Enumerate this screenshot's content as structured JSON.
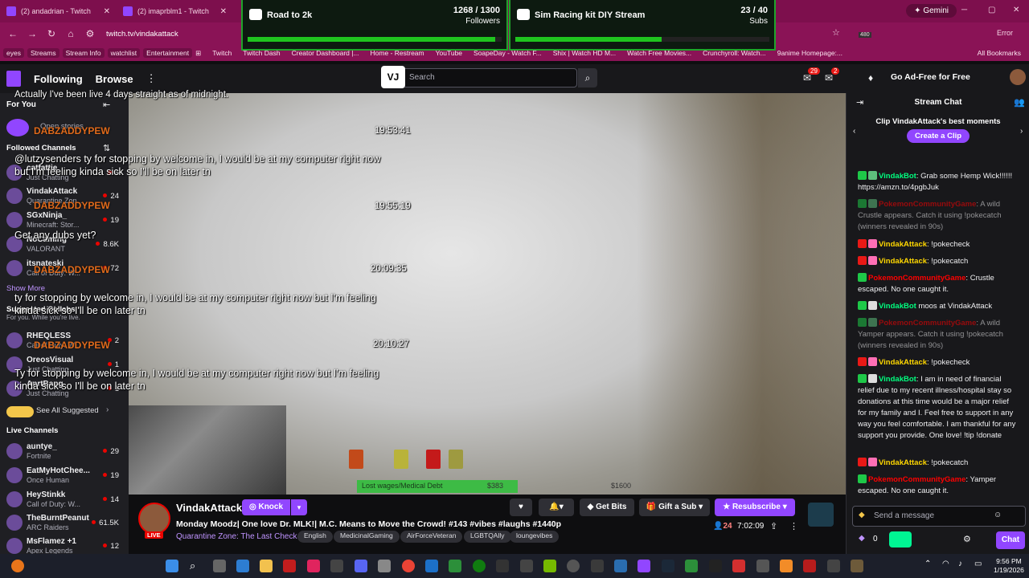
{
  "browser": {
    "tabs": [
      {
        "label": "(2) andadrian - Twitch"
      },
      {
        "label": "(2) imaprblm1 - Twitch"
      }
    ],
    "gemini_label": "Gemini",
    "url": "twitch.tv/vindakattack",
    "error_label": "Error",
    "ext_badge": "480",
    "bookmarks": [
      "eyes",
      "Streams",
      "Stream Info",
      "watchlist",
      "Entertainment"
    ],
    "bookmarks2": [
      "Twitch",
      "Twitch Dash",
      "Creator Dashboard |...",
      "Home - Restream",
      "YouTube",
      "SoapeDay - Watch F...",
      "Shix | Watch HD M...",
      "Watch Free Movies...",
      "Crunchyroll: Watch...",
      "9anime Homepage:..."
    ],
    "all_bookmarks": "All Bookmarks"
  },
  "goals": [
    {
      "title": "Road to 2k",
      "count": "1268 / 1300",
      "unit": "Followers",
      "progress": 0.975
    },
    {
      "title": "Sim Racing kit DIY Stream",
      "count": "23 / 40",
      "unit": "Subs",
      "progress": 0.575
    }
  ],
  "topnav": {
    "following": "Following",
    "browse": "Browse",
    "search_placeholder": "Search",
    "vlogo": "VJ",
    "badge1": "29",
    "badge2": "2",
    "adfree": "Go Ad-Free for Free"
  },
  "sidebar": {
    "for_you": "For You",
    "open_stories": "Open stories",
    "followed_header": "Followed Channels",
    "followed": [
      {
        "name": "catfattie",
        "game": "Just Chatting",
        "viewers": "6"
      },
      {
        "name": "VindakAttack",
        "game": "Quarantine Zon...",
        "viewers": "24"
      },
      {
        "name": "SGxNinja_",
        "game": "Minecraft: Stor...",
        "viewers": "19"
      },
      {
        "name": "NoCaming",
        "game": "VALORANT",
        "viewers": "8.6K"
      },
      {
        "name": "itsnateski",
        "game": "Call of Duty: W...",
        "viewers": "72"
      }
    ],
    "show_more": "Show More",
    "suggested_header": "Suggested Collabs",
    "suggested_sub": "For you. While you're live.",
    "suggested": [
      {
        "name": "RHEQLESS",
        "game": "Call of Duty: W...",
        "viewers": "2"
      },
      {
        "name": "OreosVisual",
        "game": "Just Chatting",
        "viewers": "1"
      },
      {
        "name": "AnrtBang",
        "game": "Just Chatting",
        "viewers": "1"
      }
    ],
    "see_all": "See All Suggested",
    "live_header": "Live Channels",
    "live": [
      {
        "name": "auntye_",
        "game": "Fortnite",
        "viewers": "29"
      },
      {
        "name": "EatMyHotChee...",
        "game": "Once Human",
        "viewers": "19"
      },
      {
        "name": "HeyStinkk",
        "game": "Call of Duty: W...",
        "viewers": "14"
      },
      {
        "name": "TheBurntPeanut",
        "game": "ARC Raiders",
        "viewers": "61.5K"
      },
      {
        "name": "MsFlamez +1",
        "game": "Apex Legends",
        "viewers": "12"
      }
    ]
  },
  "video": {
    "overlay_top": "Actually I've been live 4 days straight as of midnight.",
    "timestamps": [
      "19:53:41",
      "19:55:19",
      "20:09:35",
      "20:10:27"
    ],
    "overlay_user": "DABZADDYPEW",
    "overlay_msgs": [
      "@lutzysenders ty for stopping by welcome in, I would be at my computer right now",
      "but I'm feeling kinda sick so I'll be on later tn",
      "Get any dubs yet?",
      "ty for stopping by welcome in, I would be at my computer right now but I'm feeling",
      "kinda sick so I'll be on later tn",
      "Ty for stopping by welcome in, I would be at my computer right now but I'm feeling",
      "kinda sick so I'll be on later tn"
    ],
    "hud_debt": "Lost wages/Medical Debt",
    "hud_money1": "$383",
    "hud_money2": "$1600"
  },
  "stream": {
    "name": "VindakAttack",
    "knock": "Knock",
    "live": "LIVE",
    "title": "Monday Moodz| One love Dr. MLK!| M.C. Means to Move the Crowd! #143 #vibes #laughs #1440p",
    "game": "Quarantine Zone: The Last Check",
    "tags": [
      "English",
      "MedicinalGaming",
      "AirForceVeteran",
      "LGBTQAlly",
      "loungevibes"
    ],
    "get_bits": "Get Bits",
    "gift_sub": "Gift a Sub",
    "resubscribe": "Resubscribe",
    "viewers": "24",
    "uptime": "7:02:09"
  },
  "chat": {
    "header": "Stream Chat",
    "clip_title": "Clip VindakAttack's best moments",
    "create_clip": "Create a Clip",
    "messages": [
      {
        "user": "VindakBot",
        "color": "#00ff7f",
        "text": "Grab some Hemp Wick!!!!!! https://amzn.to/4pgbJuk"
      },
      {
        "user": "PokemonCommunityGame",
        "color": "#ff0000",
        "text": "A wild Crustle appears. Catch it using !pokecatch (winners revealed in 90s)"
      },
      {
        "user": "VindakAttack",
        "color": "#ffd700",
        "text": "!pokecheck"
      },
      {
        "user": "VindakAttack",
        "color": "#ffd700",
        "text": "!pokecatch"
      },
      {
        "user": "PokemonCommunityGame",
        "color": "#ff0000",
        "text": "Crustle escaped. No one caught it."
      },
      {
        "user": "VindakBot",
        "color": "#00ff7f",
        "text": "moos at VindakAttack"
      },
      {
        "user": "PokemonCommunityGame",
        "color": "#ff0000",
        "text": "A wild Yamper appears. Catch it using !pokecatch (winners revealed in 90s)"
      },
      {
        "user": "VindakAttack",
        "color": "#ffd700",
        "text": "!pokecheck"
      },
      {
        "user": "VindakBot",
        "color": "#00ff7f",
        "text": "I am in need of financial relief due to my recent illness/hospital stay so donations at this time would be a major relief for my family and I. Feel free to support in any way you feel comfortable. I am thankful for any support you provide. One love! !tip !donate"
      },
      {
        "user": "VindakAttack",
        "color": "#ffd700",
        "text": "!pokecatch"
      },
      {
        "user": "PokemonCommunityGame",
        "color": "#ff0000",
        "text": "Yamper escaped. No one caught it."
      }
    ],
    "input_placeholder": "Send a message",
    "points": "0",
    "chat_button": "Chat"
  },
  "taskbar": {
    "time": "9:56 PM",
    "date": "1/19/2026"
  }
}
